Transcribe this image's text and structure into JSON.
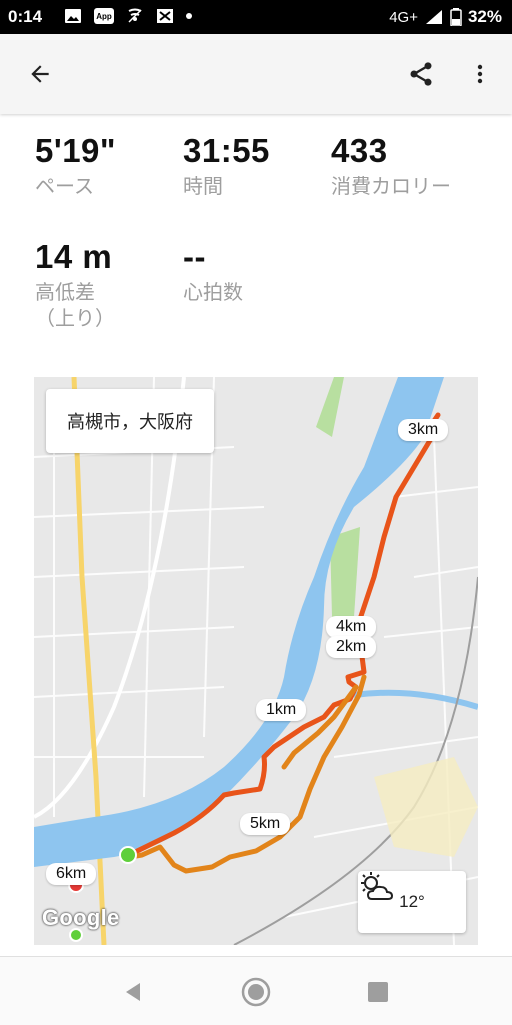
{
  "status_bar": {
    "time": "0:14",
    "app_icon_text": "App",
    "network": "4G+",
    "battery": "32%"
  },
  "app_bar": {
    "back_icon": "arrow-back-icon",
    "share_icon": "share-icon",
    "more_icon": "more-vertical-icon"
  },
  "stats": [
    {
      "value": "5'19\"",
      "label": "ペース"
    },
    {
      "value": "31:55",
      "label": "時間"
    },
    {
      "value": "433",
      "label": "消費カロリー"
    },
    {
      "value": "14 m",
      "label": "高低差\n（上り）"
    },
    {
      "value": "--",
      "label": "心拍数"
    }
  ],
  "map": {
    "location": "高槻市，大阪府",
    "km_labels": [
      "3km",
      "4km",
      "2km",
      "1km",
      "5km",
      "6km"
    ],
    "weather_temp": "12°",
    "weather_icon": "partly-cloudy-icon",
    "attribution": "Google",
    "colors": {
      "river": "#8ec5ef",
      "route_orange": "#e2841a",
      "route_red": "#e8541a",
      "land": "#e8e8e8",
      "park": "#b8dfa0"
    }
  },
  "nav_bar": {
    "back_icon": "nav-back-icon",
    "home_icon": "nav-home-icon",
    "recents_icon": "nav-recents-icon"
  }
}
